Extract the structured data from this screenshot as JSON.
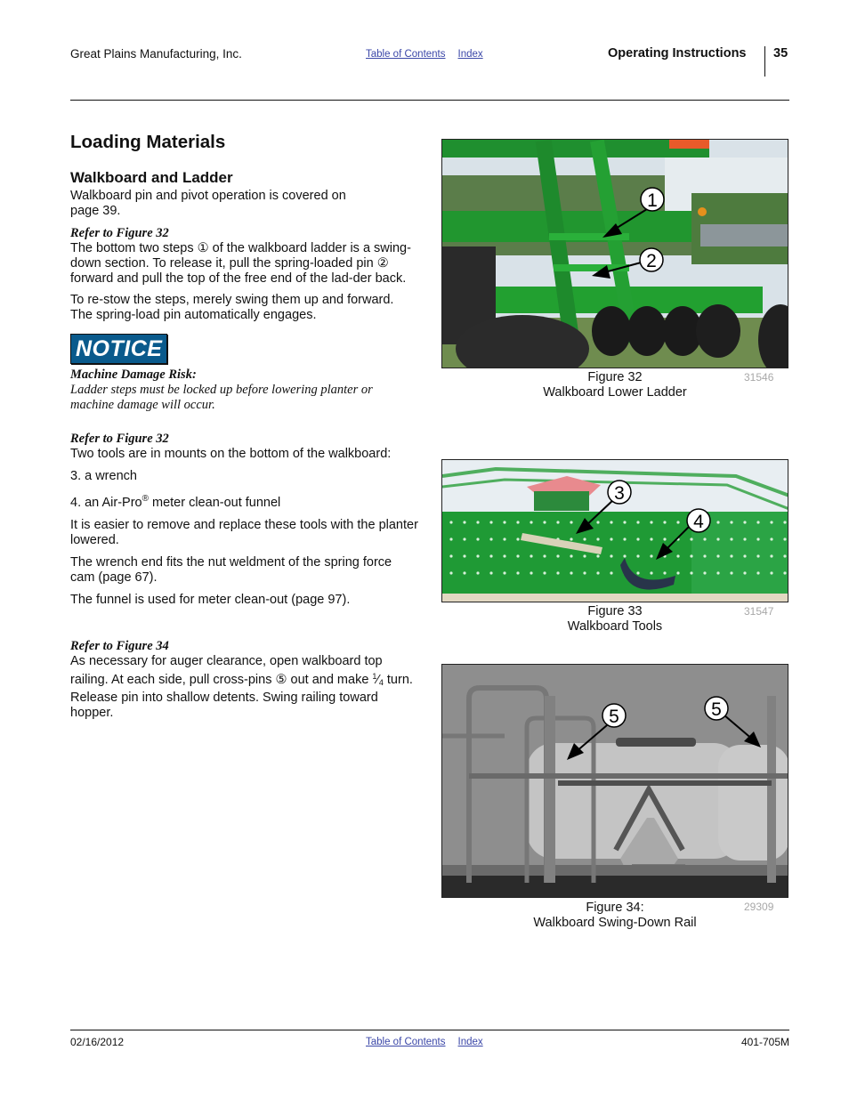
{
  "header": {
    "company": "Great Plains Manufacturing, Inc.",
    "links": [
      "Table of Contents",
      "Index"
    ],
    "section": "Operating Instructions",
    "page_number": "35"
  },
  "footer": {
    "date": "02/16/2012",
    "links": [
      "Table of Contents",
      "Index"
    ],
    "doc_number": "401-705M"
  },
  "content": {
    "title": "Loading Materials",
    "subtitle": "Walkboard and Ladder",
    "intro": "Walkboard pin and pivot operation is covered on page 39.",
    "block1": {
      "refer": "Refer to Figure 32",
      "para1": "The bottom two steps ① of the walkboard ladder is a swing-down section. To release it, pull the spring-loaded pin ② forward and pull the top of the free end of the lad-der back.",
      "para2": "To re-stow the steps, merely swing them up and forward. The spring-load pin automatically engages."
    },
    "notice": {
      "badge": "NOTICE",
      "title": "Machine Damage Risk:",
      "body": "Ladder steps must be locked up before lowering planter or machine damage will occur."
    },
    "block2": {
      "refer": "Refer to Figure 32",
      "intro": "Two tools are in mounts on the bottom of the walkboard:",
      "item3": "3. a wrench",
      "item4_pre": "4. an Air-Pro",
      "item4_reg": "®",
      "item4_post": " meter clean-out funnel",
      "para1": "It is easier to remove and replace these tools with the planter lowered.",
      "para2": "The wrench end fits the nut weldment of the spring force cam (page 67).",
      "para3": "The funnel is used for meter clean-out (page 97)."
    },
    "block3": {
      "refer": "Refer to Figure 34",
      "line_pre": "As necessary for auger clearance, open walkboard top railing. At each side, pull cross-pins ⑤ out and make",
      "frac_num": "1",
      "frac_den": "4",
      "line_post": " turn. Release pin into shallow detents. Swing railing toward hopper."
    }
  },
  "figures": [
    {
      "label": "Figure 32",
      "title": "Walkboard Lower Ladder",
      "id": "31546",
      "callouts": [
        "1",
        "2"
      ]
    },
    {
      "label": "Figure 33",
      "title": "Walkboard Tools",
      "id": "31547",
      "callouts": [
        "3",
        "4"
      ]
    },
    {
      "label": "Figure 34:",
      "title": "Walkboard Swing-Down Rail",
      "id": "29309",
      "callouts": [
        "5",
        "5"
      ]
    }
  ]
}
